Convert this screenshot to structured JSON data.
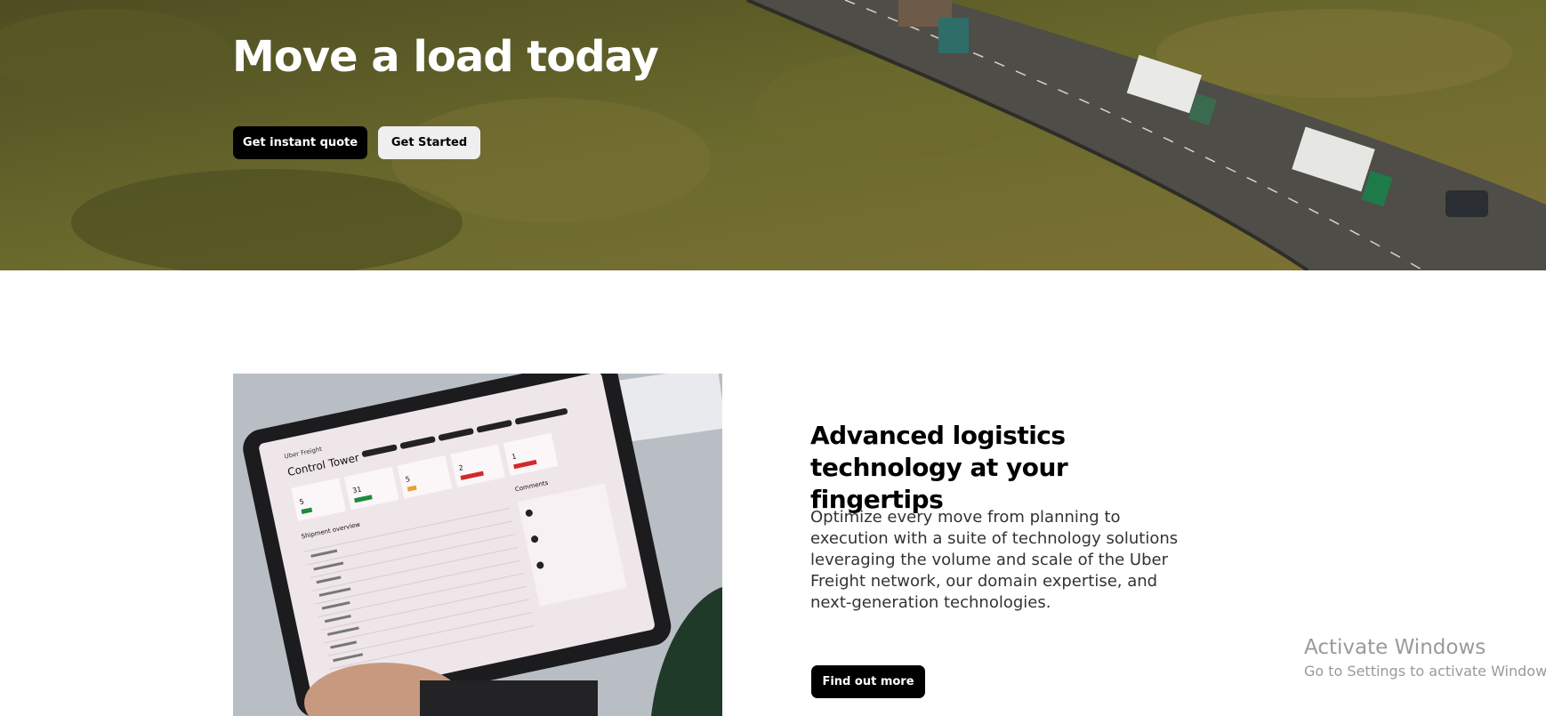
{
  "hero": {
    "title": "Move a load today",
    "quote_button": "Get instant quote",
    "started_button": "Get Started"
  },
  "tablet_screen": {
    "brand": "Uber Freight",
    "title": "Control Tower",
    "section": "Shipment overview",
    "comments": "Comments",
    "stats": [
      "5",
      "31",
      "5",
      "2",
      "1"
    ]
  },
  "feature": {
    "title": "Advanced logistics technology at your fingertips",
    "body": "Optimize every move from planning to execution with a suite of technology solutions leveraging the volume and scale of the Uber Freight network, our domain expertise, and next-generation technologies.",
    "button": "Find out more"
  },
  "watermark": {
    "title": "Activate Windows",
    "subtitle": "Go to Settings to activate Windows."
  },
  "colors": {
    "primary_button": "#000000",
    "secondary_button": "#efefef"
  }
}
